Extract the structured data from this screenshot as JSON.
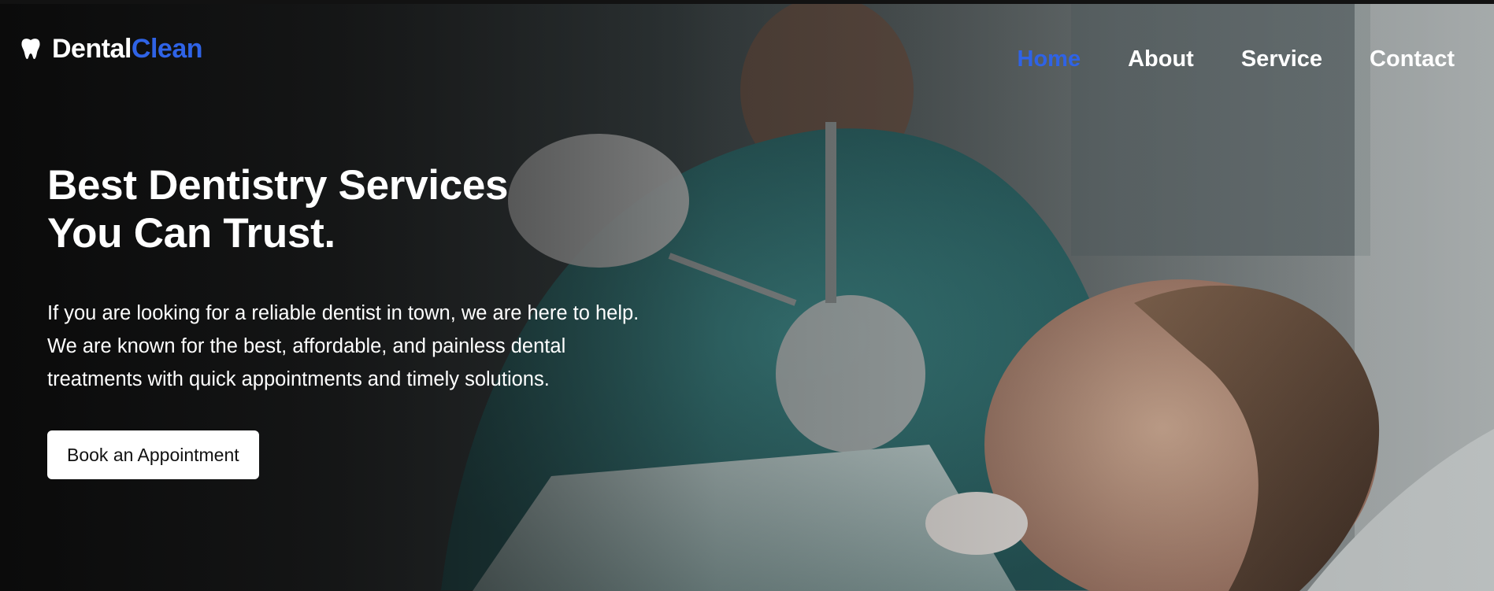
{
  "brand": {
    "name_part1": "Dental",
    "name_part2": "Clean",
    "icon": "tooth-icon"
  },
  "nav": {
    "items": [
      {
        "label": "Home",
        "active": true
      },
      {
        "label": "About",
        "active": false
      },
      {
        "label": "Service",
        "active": false
      },
      {
        "label": "Contact",
        "active": false
      }
    ]
  },
  "hero": {
    "title_line1": "Best Dentistry Services",
    "title_line2": "You Can Trust.",
    "description": "If you are looking for a reliable dentist in town, we are here to help. We are known for the best, affordable, and painless dental treatments with quick appointments and timely solutions.",
    "cta_label": "Book an Appointment"
  },
  "colors": {
    "accent": "#2f63e6",
    "text": "#ffffff",
    "button_bg": "#ffffff",
    "button_text": "#111111"
  }
}
